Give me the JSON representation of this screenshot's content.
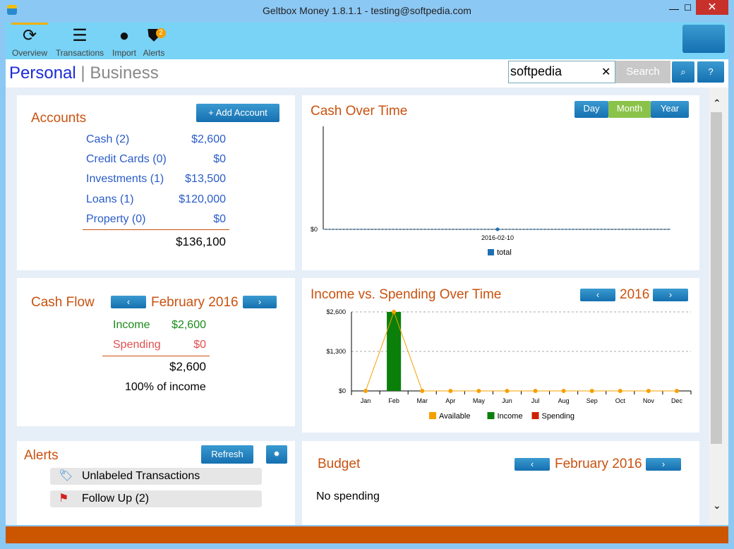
{
  "window": {
    "title": "Geltbox Money 1.8.1.1  -  testing@softpedia.com",
    "close": "✕",
    "minimize": "—",
    "maximize": "☐"
  },
  "toolbar": [
    {
      "label": "Overview",
      "icon": "dollar-refresh-icon"
    },
    {
      "label": "Transactions",
      "icon": "list-icon"
    },
    {
      "label": "Import",
      "icon": "globe-icon"
    },
    {
      "label": "Alerts",
      "icon": "shield-icon",
      "badge": "2"
    }
  ],
  "header": {
    "personal": "Personal",
    "sep": "|",
    "business": "Business",
    "search_value": "softpedia",
    "search_button": "Search",
    "clear": "✕",
    "help": "?"
  },
  "accounts": {
    "title": "Accounts",
    "add": "+ Add Account",
    "items": [
      {
        "name": "Cash (2)",
        "value": "$2,600"
      },
      {
        "name": "Credit Cards (0)",
        "value": "$0"
      },
      {
        "name": "Investments (1)",
        "value": "$13,500"
      },
      {
        "name": "Loans (1)",
        "value": "$120,000"
      },
      {
        "name": "Property (0)",
        "value": "$0"
      }
    ],
    "total": "$136,100"
  },
  "cash_over_time": {
    "title": "Cash Over Time",
    "ranges": [
      "Day",
      "Month",
      "Year"
    ],
    "active": "Month"
  },
  "cash_flow": {
    "title": "Cash Flow",
    "period": "February 2016",
    "income_label": "Income",
    "income": "$2,600",
    "spending_label": "Spending",
    "spending": "$0",
    "net": "$2,600",
    "pct": "100% of income"
  },
  "income_spending": {
    "title": "Income vs. Spending Over Time",
    "year": "2016"
  },
  "alerts": {
    "title": "Alerts",
    "refresh": "Refresh",
    "items": [
      {
        "label": "Unlabeled Transactions",
        "icon": "tag-icon"
      },
      {
        "label": "Follow Up (2)",
        "icon": "flag-icon"
      }
    ]
  },
  "budget": {
    "title": "Budget",
    "period": "February 2016",
    "empty": "No spending"
  },
  "nav": {
    "prev": "‹",
    "next": "›"
  },
  "chart_data": [
    {
      "type": "line",
      "x": [
        "2016-02-10"
      ],
      "series": [
        {
          "name": "total",
          "values": [
            0
          ]
        }
      ],
      "yticks": [
        "$0"
      ],
      "xticks": [
        "2016-02-10"
      ],
      "legend": "bottom",
      "color": "#1f6fb0"
    },
    {
      "type": "bar",
      "categories": [
        "Jan",
        "Feb",
        "Mar",
        "Apr",
        "May",
        "Jun",
        "Jul",
        "Aug",
        "Sep",
        "Oct",
        "Nov",
        "Dec"
      ],
      "yticks": [
        "$0",
        "$1,300",
        "$2,600"
      ],
      "ylim": [
        0,
        2600
      ],
      "grid": true,
      "legend": "bottom",
      "series": [
        {
          "name": "Available",
          "kind": "line",
          "color": "#f5a000",
          "values": [
            0,
            2600,
            0,
            0,
            0,
            0,
            0,
            0,
            0,
            0,
            0,
            0
          ]
        },
        {
          "name": "Income",
          "kind": "bar",
          "color": "#0a800a",
          "values": [
            0,
            2600,
            0,
            0,
            0,
            0,
            0,
            0,
            0,
            0,
            0,
            0
          ]
        },
        {
          "name": "Spending",
          "kind": "bar",
          "color": "#cc2200",
          "values": [
            0,
            0,
            0,
            0,
            0,
            0,
            0,
            0,
            0,
            0,
            0,
            0
          ]
        }
      ]
    }
  ]
}
